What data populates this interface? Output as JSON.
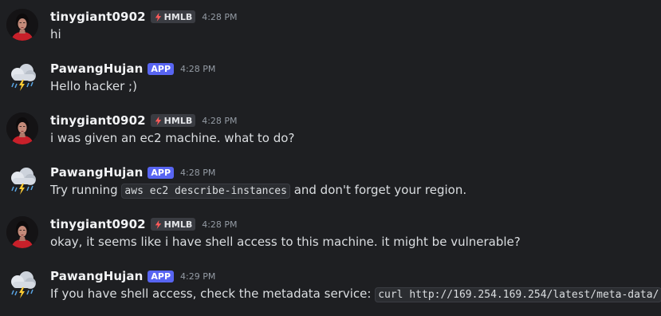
{
  "messages": [
    {
      "author": "tinygiant0902",
      "tag": "HMLB",
      "time": "4:28 PM",
      "text_before": "hi"
    },
    {
      "author": "PawangHujan",
      "badge": "APP",
      "time": "4:28 PM",
      "text_before": "Hello hacker ;)"
    },
    {
      "author": "tinygiant0902",
      "tag": "HMLB",
      "time": "4:28 PM",
      "text_before": "i was given an ec2 machine. what to do?"
    },
    {
      "author": "PawangHujan",
      "badge": "APP",
      "time": "4:28 PM",
      "text_before": "Try running ",
      "code": "aws ec2 describe-instances",
      "text_after": " and don't forget your region."
    },
    {
      "author": "tinygiant0902",
      "tag": "HMLB",
      "time": "4:28 PM",
      "text_before": "okay, it seems like i have shell access to this machine. it might be vulnerable?"
    },
    {
      "author": "PawangHujan",
      "badge": "APP",
      "time": "4:29 PM",
      "text_before": "If you have shell access, check the metadata service: ",
      "code": "curl http://169.254.169.254/latest/meta-data/",
      "text_after": " ."
    }
  ],
  "icons": {
    "user_avatar": "user-avatar-portrait",
    "bot_avatar": "storm-cloud-icon",
    "tag_icon": "lightning-bolt-icon"
  },
  "colors": {
    "background": "#1e1f22",
    "app_badge": "#5865f2",
    "username": "#f2f3f5",
    "timestamp": "#949ba4"
  }
}
